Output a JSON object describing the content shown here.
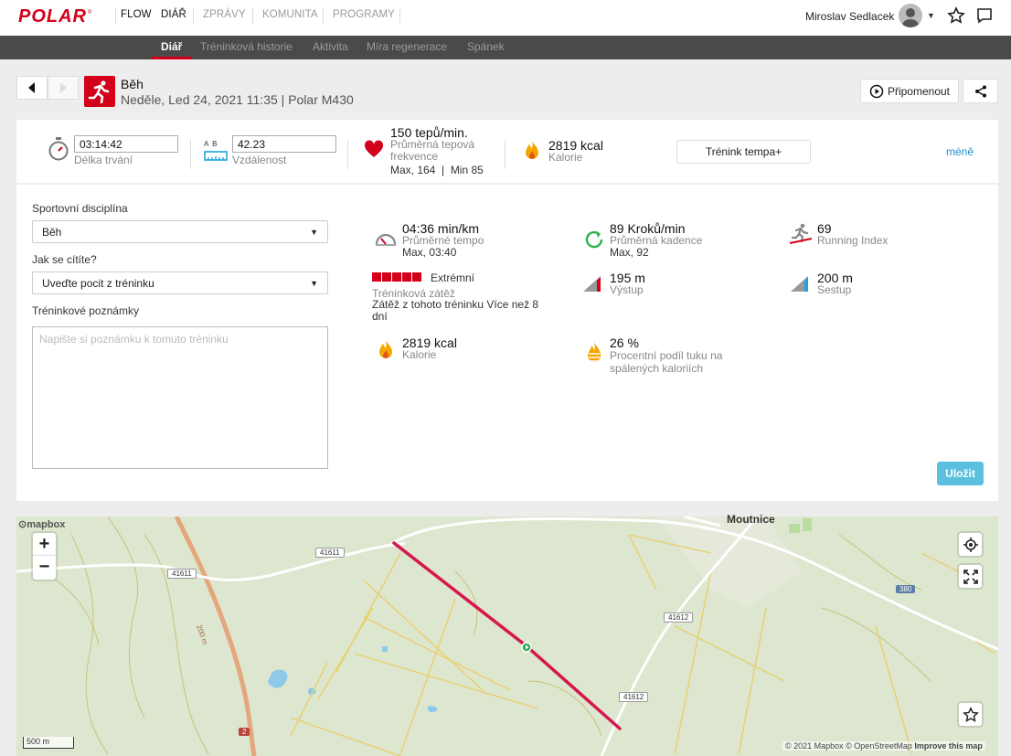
{
  "nav": {
    "brand": "POLAR",
    "flow": "FLOW",
    "items": [
      "DIÁŘ",
      "ZPRÁVY",
      "KOMUNITA",
      "PROGRAMY"
    ],
    "user": "Miroslav Sedlacek"
  },
  "subnav": [
    "Diář",
    "Tréninková historie",
    "Aktivita",
    "Míra regenerace",
    "Spánek"
  ],
  "session": {
    "sport": "Běh",
    "datetime": "Neděle, Led 24, 2021 11:35 | Polar M430",
    "remind": "Připomenout"
  },
  "summary": {
    "duration": {
      "value": "03:14:42",
      "label": "Délka trvání"
    },
    "distance": {
      "ab": "A  B",
      "value": "42.23",
      "label": "Vzdálenost"
    },
    "hr": {
      "value": "150 tepů/min.",
      "label": "Průměrná tepová frekvence",
      "max": "Max, 164  |  Min 85"
    },
    "calories": {
      "value": "2819 kcal",
      "label": "Kalorie"
    },
    "tempo_btn": "Trénink tempa+",
    "less": "méně"
  },
  "form": {
    "sport_label": "Sportovní disciplína",
    "sport_value": "Běh",
    "feel_label": "Jak se cítíte?",
    "feel_value": "Uveďte pocit z tréninku",
    "notes_label": "Tréninkové poznámky",
    "notes_placeholder": "Napište si poznámku k tomuto tréninku",
    "save": "Uložit"
  },
  "metrics": {
    "pace": {
      "value": "04:36 min/km",
      "label": "Průměrné tempo",
      "sub": "Max, 03:40"
    },
    "cadence": {
      "value": "89 Kroků/min",
      "label": "Průměrná kadence",
      "sub": "Max, 92"
    },
    "running_index": {
      "value": "69",
      "label": "Running Index"
    },
    "load": {
      "value": "Extrémní",
      "label": "Tréninková zátěž",
      "sub": "Zátěž z tohoto tréninku Více než 8 dní",
      "squares": 5
    },
    "ascent": {
      "value": "195 m",
      "label": "Výstup"
    },
    "descent": {
      "value": "200 m",
      "label": "Sestup"
    },
    "calories": {
      "value": "2819 kcal",
      "label": "Kalorie"
    },
    "fat": {
      "value": "26 %",
      "label": "Procentní podíl tuku na spálených kaloriích"
    }
  },
  "map": {
    "brand": "mapbox",
    "place": "Moutnice",
    "roads": [
      "41611",
      "41611",
      "41612",
      "41612",
      "380",
      "2",
      "200 m"
    ],
    "scale": "500 m",
    "attribution": "© 2021 Mapbox © OpenStreetMap",
    "improve": "Improve this map"
  },
  "colors": {
    "accent": "#d4001a",
    "save_button": "#5bc0de",
    "route": "#d6164d",
    "map_bg": "#dde6cf"
  }
}
